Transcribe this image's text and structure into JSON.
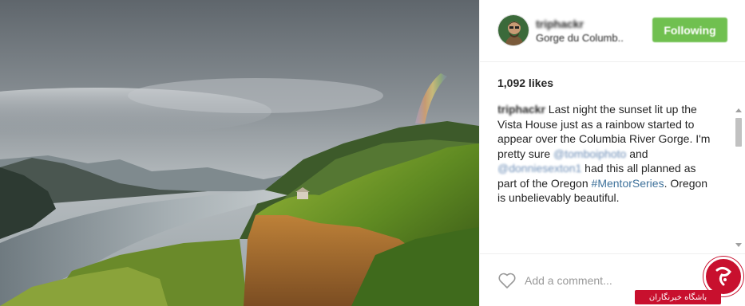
{
  "post": {
    "username": "triphackr",
    "location": "Gorge du Columb..",
    "follow_label": "Following",
    "likes": "1,092 likes"
  },
  "caption": {
    "username": "triphackr",
    "text1": " Last night the sunset lit up the Vista House just as a rainbow started to appear over the Columbia River Gorge. I'm pretty sure ",
    "mention1": "@tomboiphoto",
    "text2": " and ",
    "mention2": "@donniesexton1",
    "text3": " had this all planned as part of the Oregon ",
    "hashtag": "#MentorSeries",
    "text4": ". Oregon is unbelievably beautiful."
  },
  "comment": {
    "placeholder": "Add a comment..."
  },
  "watermark": {
    "text": "باشگاه خبرنگاران"
  },
  "colors": {
    "follow_bg": "#70c050",
    "hashtag": "#3f729b",
    "watermark": "#c8102e"
  },
  "icons": {
    "like": "heart-outline-icon"
  }
}
